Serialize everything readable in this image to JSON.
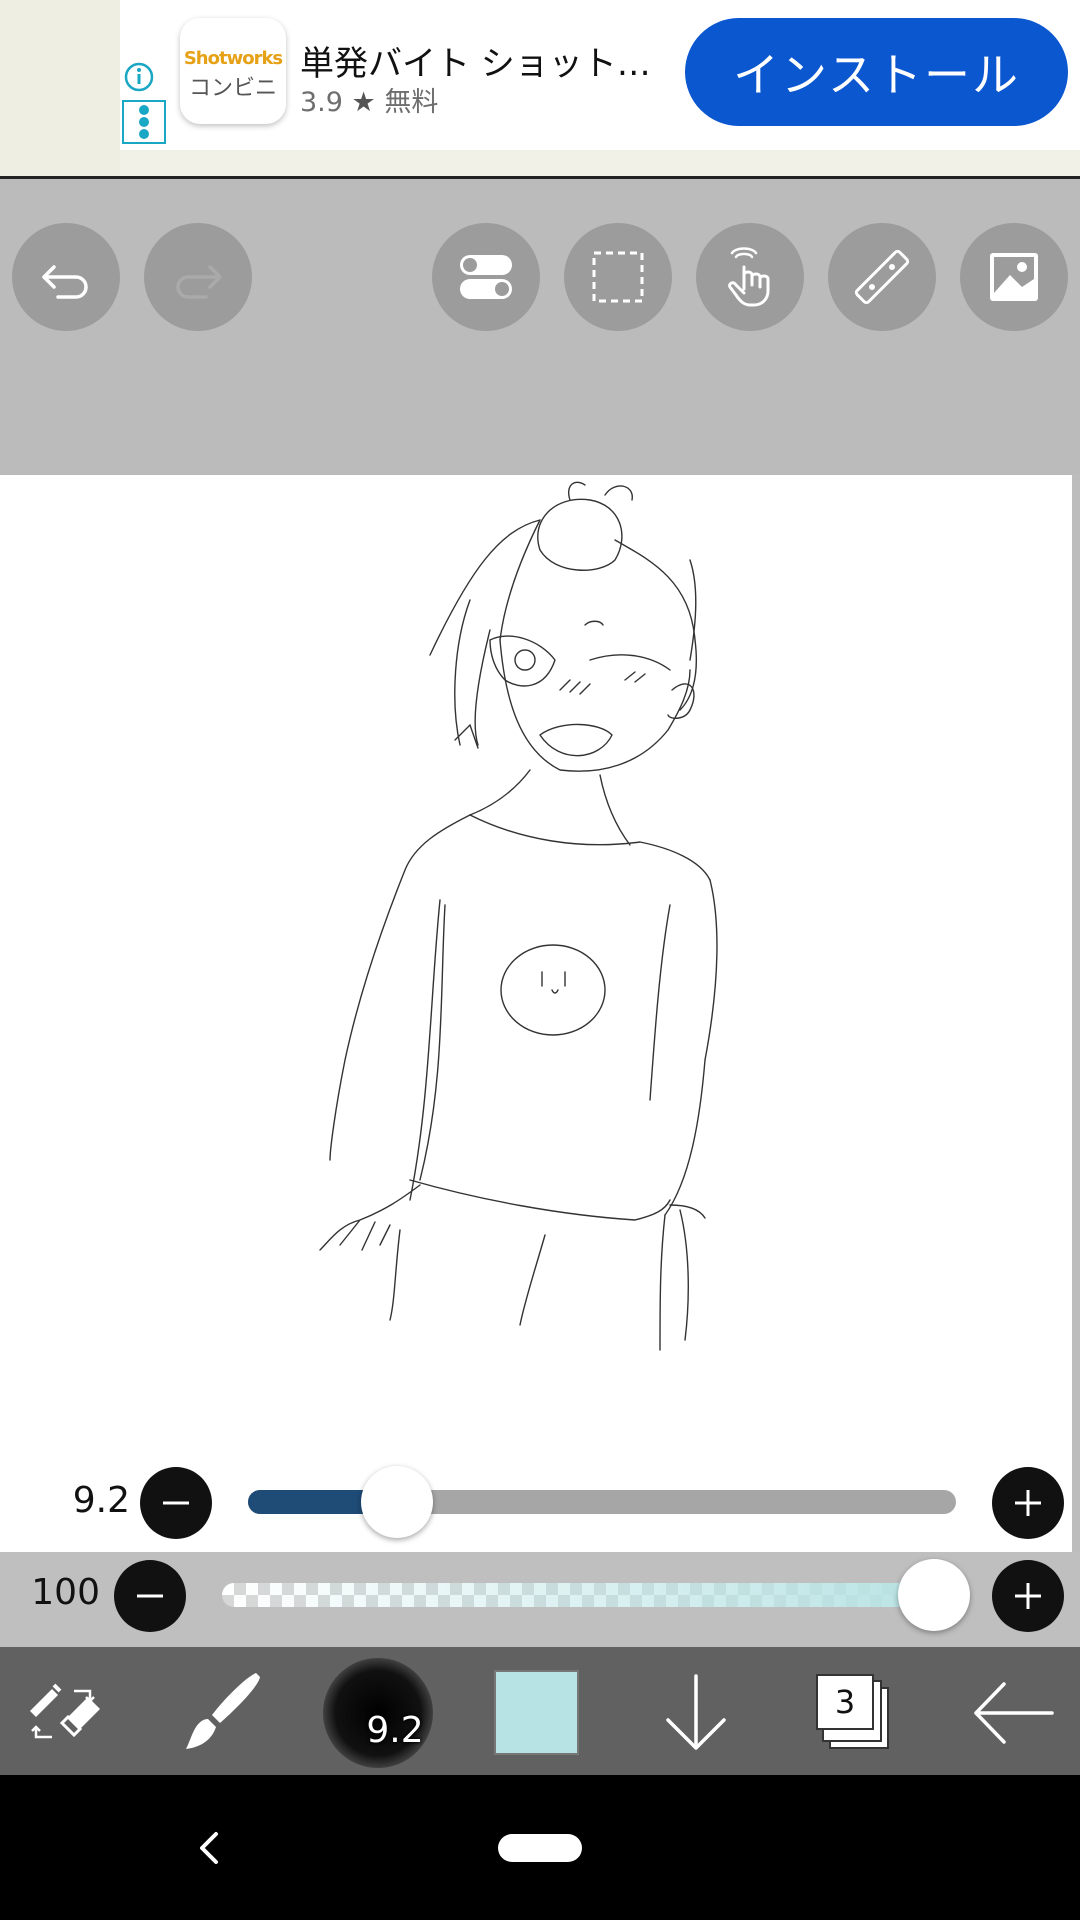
{
  "ad": {
    "app_icon_line1": "Shotworks",
    "app_icon_line2": "コンビニ",
    "title": "単発バイト ショット…",
    "rating": "3.9",
    "star": "★",
    "price": "無料",
    "install_label": "インストール"
  },
  "toolbar": {
    "buttons": [
      "undo-icon",
      "redo-icon",
      "toggle-icon",
      "selection-icon",
      "hand-icon",
      "ruler-icon",
      "image-icon"
    ]
  },
  "brush": {
    "size_label": "9.2",
    "size_fraction": 0.21,
    "opacity_label": "100",
    "opacity_fraction": 1.0,
    "preview_text": "9.2"
  },
  "colors": {
    "current_color": "#b8e3e4",
    "accent": "#0b57d0",
    "size_fill": "#1f4b77"
  },
  "bottom_bar": {
    "layer_count": "3"
  }
}
